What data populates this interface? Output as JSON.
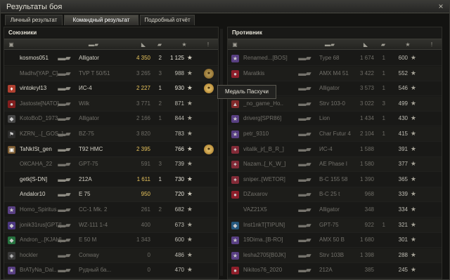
{
  "window": {
    "title": "Результаты боя",
    "close": "×"
  },
  "tabs": [
    {
      "label": "Личный результат"
    },
    {
      "label": "Командный результат"
    },
    {
      "label": "Подробный отчёт"
    }
  ],
  "allies": {
    "title": "Союзники",
    "rows": [
      {
        "name": "kosmos051",
        "tank": "Alligator",
        "damage": "4 350",
        "frags": "2",
        "xp": "1 125",
        "medal": false,
        "dead": false,
        "badge": "",
        "badge_color": ""
      },
      {
        "name": "Madhv[YAP_C]",
        "tank": "TVP T 50/51",
        "damage": "3 265",
        "frags": "3",
        "xp": "988",
        "medal": true,
        "dead": true,
        "badge": "",
        "badge_color": ""
      },
      {
        "name": "vintokryl13",
        "tank": "ИС-4",
        "damage": "2 227",
        "frags": "1",
        "xp": "930",
        "medal": true,
        "dead": false,
        "badge": "♦",
        "badge_color": "#b04030"
      },
      {
        "name": "Jastoste[NATO]",
        "tank": "Wilk",
        "damage": "3 771",
        "frags": "2",
        "xp": "871",
        "medal": false,
        "dead": true,
        "badge": "●",
        "badge_color": "#a02020"
      },
      {
        "name": "KotoBoD_1973",
        "tank": "Alligator",
        "damage": "2 166",
        "frags": "1",
        "xp": "844",
        "medal": false,
        "dead": true,
        "badge": "◆",
        "badge_color": "#555"
      },
      {
        "name": "KZRN_..[_GOS_]",
        "tank": "BZ-75",
        "damage": "3 820",
        "frags": "",
        "xp": "783",
        "medal": false,
        "dead": true,
        "badge": "⚑",
        "badge_color": "#333"
      },
      {
        "name": "TaNkISt_gen",
        "tank": "T92 HMC",
        "damage": "2 395",
        "frags": "",
        "xp": "766",
        "medal": true,
        "dead": false,
        "badge": "▣",
        "badge_color": "#7a5a30"
      },
      {
        "name": "ОКСАНА_22",
        "tank": "GPT-75",
        "damage": "591",
        "frags": "3",
        "xp": "739",
        "medal": false,
        "dead": true,
        "badge": "",
        "badge_color": ""
      },
      {
        "name": "getk[S-DN]",
        "tank": "212A",
        "damage": "1 611",
        "frags": "1",
        "xp": "730",
        "medal": false,
        "dead": false,
        "badge": "",
        "badge_color": ""
      },
      {
        "name": "Andalor10",
        "tank": "E 75",
        "damage": "950",
        "frags": "",
        "xp": "720",
        "medal": false,
        "dead": false,
        "badge": "",
        "badge_color": ""
      },
      {
        "name": "Homo_Spiritus",
        "tank": "CC-1 Mk. 2",
        "damage": "261",
        "frags": "2",
        "xp": "682",
        "medal": false,
        "dead": true,
        "badge": "★",
        "badge_color": "#6a4aa0"
      },
      {
        "name": "jonik31rus[GPTI]",
        "tank": "WZ-111 1-4",
        "damage": "400",
        "frags": "",
        "xp": "673",
        "medal": false,
        "dead": true,
        "badge": "◆",
        "badge_color": "#5a40a0"
      },
      {
        "name": "Andron_..[KJAH]",
        "tank": "E 50 M",
        "damage": "1 343",
        "frags": "",
        "xp": "600",
        "medal": false,
        "dead": true,
        "badge": "◆",
        "badge_color": "#2a8a4a"
      },
      {
        "name": "hockler",
        "tank": "Conway",
        "damage": "0",
        "frags": "",
        "xp": "486",
        "medal": false,
        "dead": true,
        "badge": "◈",
        "badge_color": "#444"
      },
      {
        "name": "BrATyNa_Dal..",
        "tank": "Рудный ба...",
        "damage": "0",
        "frags": "",
        "xp": "470",
        "medal": false,
        "dead": true,
        "badge": "★",
        "badge_color": "#6a4aa0"
      }
    ]
  },
  "enemies": {
    "title": "Противник",
    "rows": [
      {
        "name": "Renamed...[BOS]",
        "tank": "Type 68",
        "damage": "1 674",
        "frags": "1",
        "xp": "600",
        "dead": true,
        "badge": "★",
        "badge_color": "#6a4aa0"
      },
      {
        "name": "Maratkis",
        "tank": "AMX M4 51",
        "damage": "3 422",
        "frags": "1",
        "xp": "552",
        "dead": true,
        "badge": "●",
        "badge_color": "#b02030"
      },
      {
        "name": "",
        "tank": "Alligator",
        "damage": "3 573",
        "frags": "1",
        "xp": "546",
        "dead": true,
        "badge": "",
        "badge_color": ""
      },
      {
        "name": "_no_game_Ho..",
        "tank": "Strv 103-0",
        "damage": "3 022",
        "frags": "3",
        "xp": "499",
        "dead": true,
        "badge": "▲",
        "badge_color": "#a03030"
      },
      {
        "name": "driverg[SPR86]",
        "tank": "Lion",
        "damage": "1 434",
        "frags": "1",
        "xp": "430",
        "dead": true,
        "badge": "★",
        "badge_color": "#6a4aa0"
      },
      {
        "name": "petr_9310",
        "tank": "Char Futur 4",
        "damage": "2 104",
        "frags": "1",
        "xp": "415",
        "dead": true,
        "badge": "★",
        "badge_color": "#6a4aa0"
      },
      {
        "name": "vitalik_jr[_B_R_]",
        "tank": "ИС-4",
        "damage": "1 588",
        "frags": "",
        "xp": "391",
        "dead": true,
        "badge": "✦",
        "badge_color": "#a03040"
      },
      {
        "name": "Nazam..[_K_W_]",
        "tank": "AE Phase I",
        "damage": "1 580",
        "frags": "",
        "xp": "377",
        "dead": true,
        "badge": "✦",
        "badge_color": "#a03040"
      },
      {
        "name": "sniper..[WETOR]",
        "tank": "B-C 155 58",
        "damage": "1 390",
        "frags": "",
        "xp": "365",
        "dead": true,
        "badge": "✦",
        "badge_color": "#a03040"
      },
      {
        "name": "DZaxarov",
        "tank": "B-C 25 t",
        "damage": "968",
        "frags": "",
        "xp": "339",
        "dead": true,
        "badge": "●",
        "badge_color": "#b02030"
      },
      {
        "name": "VAZ21X5",
        "tank": "Alligator",
        "damage": "348",
        "frags": "",
        "xp": "334",
        "dead": true,
        "badge": "",
        "badge_color": ""
      },
      {
        "name": "Inst1nkT[TIPUN]",
        "tank": "GPT-75",
        "damage": "922",
        "frags": "1",
        "xp": "321",
        "dead": true,
        "badge": "◆",
        "badge_color": "#2a6a9a"
      },
      {
        "name": "19Dima..[B-RO]",
        "tank": "AMX 50 B",
        "damage": "1 680",
        "frags": "",
        "xp": "301",
        "dead": true,
        "badge": "★",
        "badge_color": "#6a4aa0"
      },
      {
        "name": "lesha2705[B0JK]",
        "tank": "Strv 103B",
        "damage": "1 398",
        "frags": "",
        "xp": "288",
        "dead": true,
        "badge": "★",
        "badge_color": "#6a4aa0"
      },
      {
        "name": "Nikitos76_2020",
        "tank": "212A",
        "damage": "385",
        "frags": "",
        "xp": "245",
        "dead": true,
        "badge": "●",
        "badge_color": "#b02030"
      }
    ]
  },
  "tooltip": {
    "text": "Медаль Пасхучи"
  },
  "icons": {
    "star": "★",
    "tank": "▬▰"
  }
}
